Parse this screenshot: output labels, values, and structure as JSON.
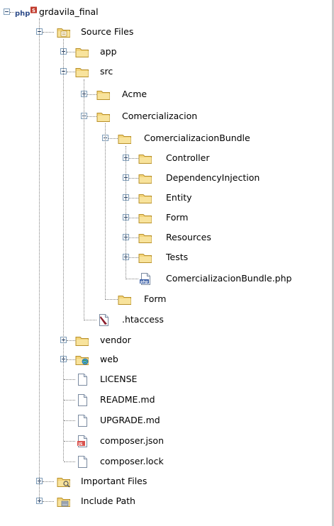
{
  "tree": {
    "root": {
      "label": "grdavila_final",
      "php_badge": "php",
      "state": "expanded"
    },
    "source_files": {
      "label": "Source Files",
      "state": "expanded"
    },
    "app": {
      "label": "app",
      "state": "collapsed"
    },
    "src": {
      "label": "src",
      "state": "expanded"
    },
    "acme": {
      "label": "Acme",
      "state": "collapsed"
    },
    "comercializacion": {
      "label": "Comercializacion",
      "state": "expanded"
    },
    "comercializacion_bundle": {
      "label": "ComercializacionBundle",
      "state": "expanded"
    },
    "controller": {
      "label": "Controller",
      "state": "collapsed"
    },
    "dependency_injection": {
      "label": "DependencyInjection",
      "state": "collapsed"
    },
    "entity": {
      "label": "Entity",
      "state": "collapsed"
    },
    "form_inner": {
      "label": "Form",
      "state": "collapsed"
    },
    "resources": {
      "label": "Resources",
      "state": "collapsed"
    },
    "tests": {
      "label": "Tests",
      "state": "collapsed"
    },
    "bundle_php": {
      "label": "ComercializacionBundle.php"
    },
    "form_outer": {
      "label": "Form"
    },
    "htaccess": {
      "label": ".htaccess"
    },
    "vendor": {
      "label": "vendor",
      "state": "collapsed"
    },
    "web": {
      "label": "web",
      "state": "collapsed"
    },
    "license": {
      "label": "LICENSE"
    },
    "readme": {
      "label": "README.md"
    },
    "upgrade": {
      "label": "UPGRADE.md"
    },
    "composer_json": {
      "label": "composer.json",
      "badge": "JS"
    },
    "composer_lock": {
      "label": "composer.lock"
    },
    "important_files": {
      "label": "Important Files",
      "state": "collapsed"
    },
    "include_path": {
      "label": "Include Path",
      "state": "collapsed"
    }
  },
  "colors": {
    "folder_fill": "#f3d47a",
    "folder_stroke": "#b8902a",
    "tree_line": "#808080",
    "expander_border": "#7f9db9"
  }
}
